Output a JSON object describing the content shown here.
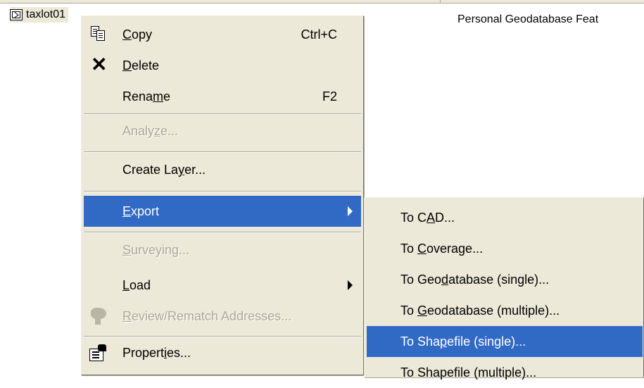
{
  "list": {
    "row": {
      "name": "taxlot01",
      "type": "Personal Geodatabase Feat"
    }
  },
  "context_menu": {
    "items": [
      {
        "id": "copy",
        "pre": "",
        "key": "C",
        "post": "opy",
        "shortcut": "Ctrl+C",
        "icon": "copy-icon",
        "enabled": true
      },
      {
        "id": "delete",
        "pre": "",
        "key": "D",
        "post": "elete",
        "shortcut": "",
        "icon": "delete-x-icon",
        "enabled": true
      },
      {
        "id": "rename",
        "pre": "Rena",
        "key": "m",
        "post": "e",
        "shortcut": "F2",
        "icon": "",
        "enabled": true
      },
      {
        "id": "analyze",
        "pre": "Analy",
        "key": "z",
        "post": "e...",
        "shortcut": "",
        "icon": "",
        "enabled": false
      },
      {
        "id": "create-layer",
        "pre": "Create La",
        "key": "y",
        "post": "er...",
        "shortcut": "",
        "icon": "",
        "enabled": true
      },
      {
        "id": "export",
        "pre": "",
        "key": "E",
        "post": "xport",
        "shortcut": "",
        "icon": "",
        "enabled": true,
        "submenu": true,
        "highlighted": true
      },
      {
        "id": "surveying",
        "pre": "",
        "key": "S",
        "post": "urveying...",
        "shortcut": "",
        "icon": "",
        "enabled": false
      },
      {
        "id": "load",
        "pre": "",
        "key": "L",
        "post": "oad",
        "shortcut": "",
        "icon": "",
        "enabled": true,
        "submenu": true
      },
      {
        "id": "review-rematch",
        "pre": "",
        "key": "R",
        "post": "eview/Rematch Addresses...",
        "shortcut": "",
        "icon": "review-rematch-icon",
        "enabled": false
      },
      {
        "id": "properties",
        "pre": "Propert",
        "key": "i",
        "post": "es...",
        "shortcut": "",
        "icon": "properties-icon",
        "enabled": true
      }
    ]
  },
  "export_submenu": {
    "items": [
      {
        "id": "to-cad",
        "pre": "To C",
        "key": "A",
        "post": "D..."
      },
      {
        "id": "to-coverage",
        "pre": "To ",
        "key": "C",
        "post": "overage..."
      },
      {
        "id": "to-geodatabase-single",
        "pre": "To Geo",
        "key": "d",
        "post": "atabase (single)..."
      },
      {
        "id": "to-geodatabase-multiple",
        "pre": "To ",
        "key": "G",
        "post": "eodatabase (multiple)..."
      },
      {
        "id": "to-shapefile-single",
        "pre": "To Sha",
        "key": "p",
        "post": "efile (single)...",
        "highlighted": true
      },
      {
        "id": "to-shapefile-multiple",
        "pre": "To Shapefile (multiple)...",
        "key": "",
        "post": ""
      }
    ]
  },
  "colors": {
    "menu_bg": "#ece9d8",
    "highlight": "#316ac5",
    "disabled_text": "#aca899"
  }
}
